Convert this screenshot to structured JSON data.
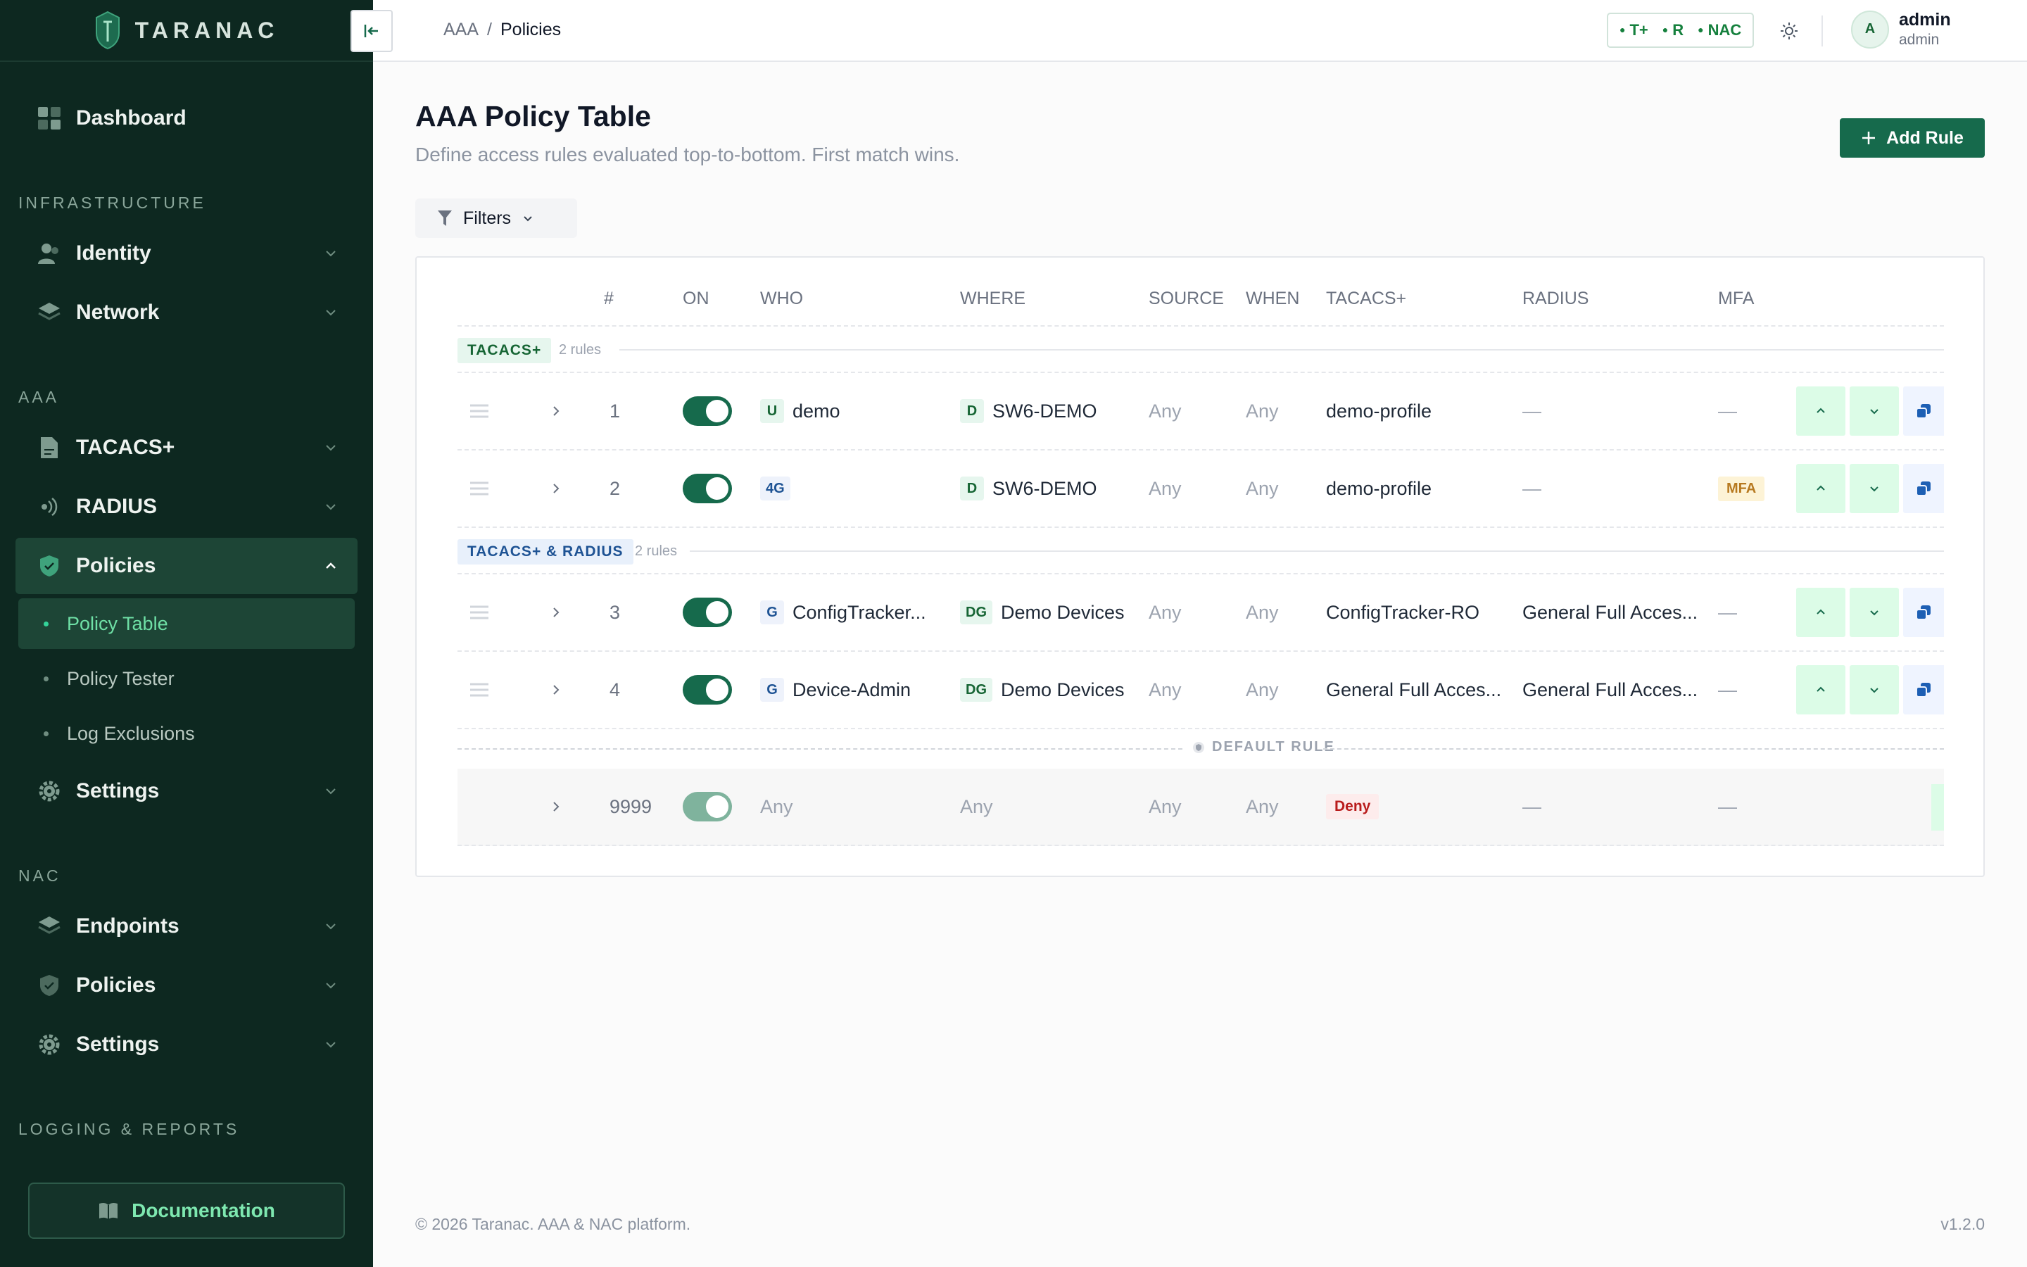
{
  "brand": {
    "name": "TARANAC"
  },
  "sidebar": {
    "dashboard": "Dashboard",
    "sections": {
      "infrastructure": "INFRASTRUCTURE",
      "aaa": "AAA",
      "nac": "NAC",
      "logging": "LOGGING & REPORTS"
    },
    "identity": "Identity",
    "network": "Network",
    "tacacs": "TACACS+",
    "radius": "RADIUS",
    "policies": "Policies",
    "policy_sub": [
      "Policy Table",
      "Policy Tester",
      "Log Exclusions"
    ],
    "settings": "Settings",
    "endpoints": "Endpoints",
    "nac_policies": "Policies",
    "nac_settings": "Settings",
    "documentation": "Documentation"
  },
  "topbar": {
    "breadcrumb": [
      "AAA",
      "/",
      "Policies"
    ],
    "protocols": [
      "T+",
      "R",
      "NAC"
    ],
    "user_initial": "A",
    "user_name": "admin",
    "user_role": "admin"
  },
  "page": {
    "title": "AAA Policy Table",
    "subtitle": "Define access rules evaluated top-to-bottom. First match wins.",
    "add_button": "Add Rule",
    "filters": "Filters"
  },
  "table": {
    "headers": [
      "#",
      "ON",
      "WHO",
      "WHERE",
      "SOURCE",
      "WHEN",
      "TACACS+",
      "RADIUS",
      "MFA"
    ],
    "groups": [
      {
        "label": "TACACS+",
        "count": "2 rules",
        "rows": [
          {
            "num": "1",
            "who_tag": "U",
            "who": "demo",
            "where_tag": "D",
            "where": "SW6-DEMO",
            "source": "Any",
            "when": "Any",
            "tacacs": "demo-profile",
            "radius": "—",
            "mfa": "—"
          },
          {
            "num": "2",
            "who_tag": "4G",
            "who": "",
            "where_tag": "D",
            "where": "SW6-DEMO",
            "source": "Any",
            "when": "Any",
            "tacacs": "demo-profile",
            "radius": "—",
            "mfa": "MFA"
          }
        ]
      },
      {
        "label": "TACACS+ & RADIUS",
        "count": "2 rules",
        "rows": [
          {
            "num": "3",
            "who_tag": "G",
            "who": "ConfigTracker...",
            "where_tag": "DG",
            "where": "Demo Devices",
            "source": "Any",
            "when": "Any",
            "tacacs": "ConfigTracker-RO",
            "radius": "General Full Acces...",
            "mfa": "—"
          },
          {
            "num": "4",
            "who_tag": "G",
            "who": "Device-Admin",
            "where_tag": "DG",
            "where": "Demo Devices",
            "source": "Any",
            "when": "Any",
            "tacacs": "General Full Acces...",
            "radius": "General Full Acces...",
            "mfa": "—"
          }
        ]
      }
    ],
    "default_label": "DEFAULT RULE",
    "default_row": {
      "num": "9999",
      "who": "Any",
      "where": "Any",
      "source": "Any",
      "when": "Any",
      "tacacs": "Deny",
      "radius": "—",
      "mfa": "—"
    }
  },
  "footer": {
    "copyright": "© 2026 Taranac. AAA & NAC platform.",
    "version": "v1.2.0"
  },
  "colors": {
    "sidebar_bg": "#0d2820",
    "accent": "#166a4c",
    "active_sub_text": "#6fe0a6"
  }
}
